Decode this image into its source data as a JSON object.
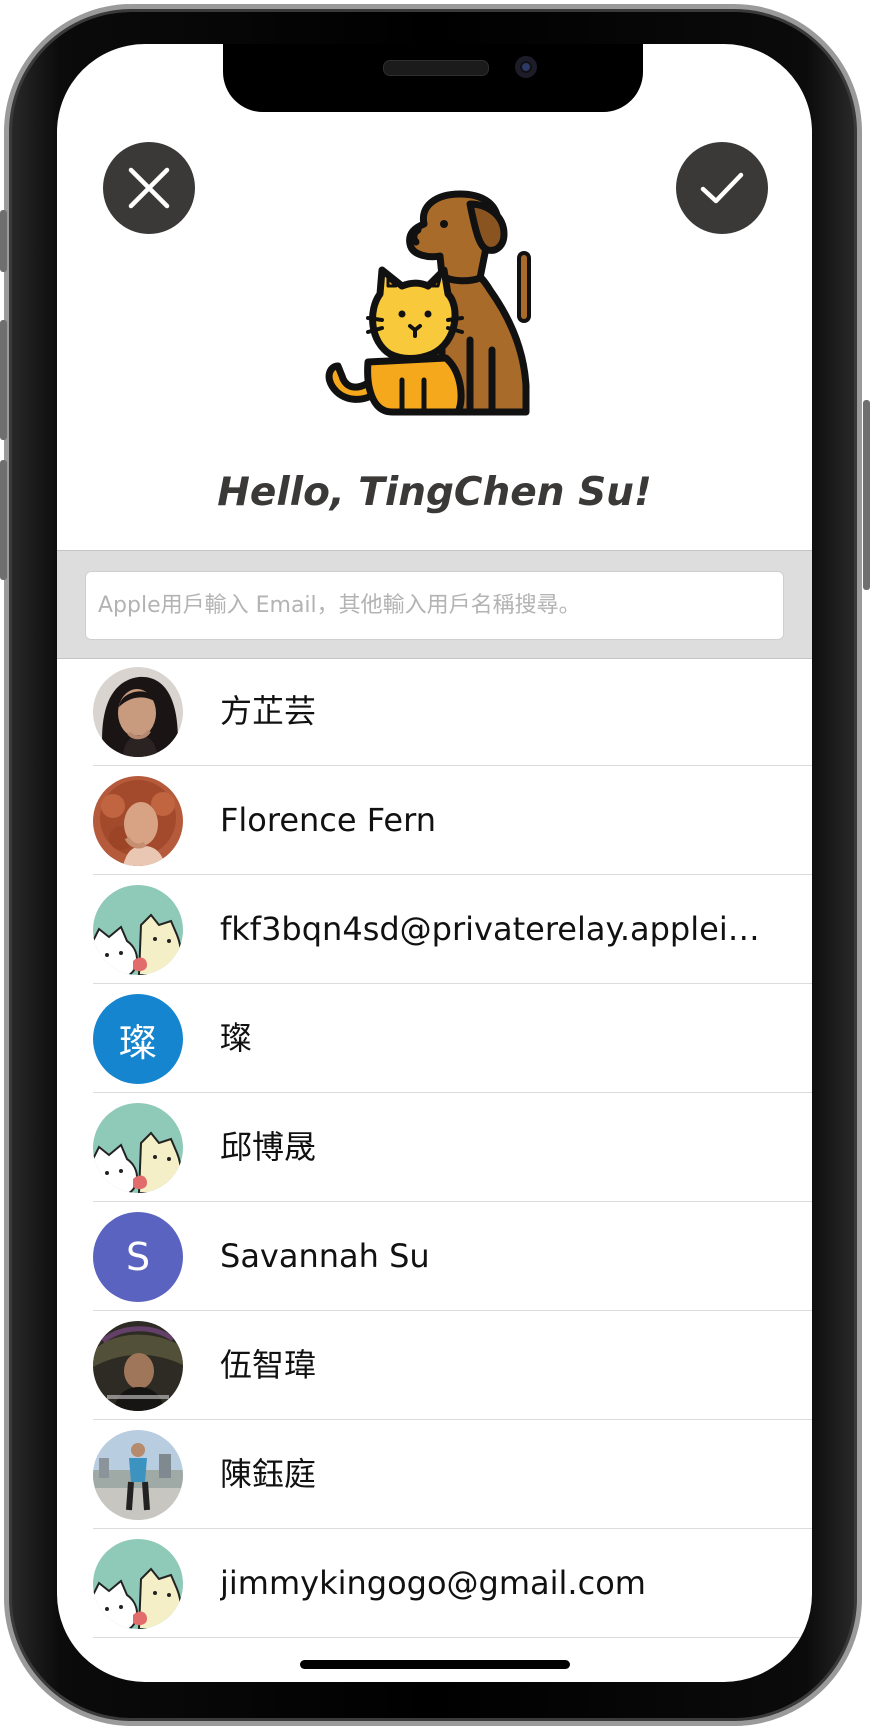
{
  "header": {
    "cancel_icon": "close-icon",
    "confirm_icon": "checkmark-icon",
    "greeting": "Hello, TingChen Su!"
  },
  "search": {
    "placeholder": "Apple用戶輸入 Email，其他輸入用戶名稱搜尋。"
  },
  "contacts": [
    {
      "name": "方芷芸",
      "avatar": "photo"
    },
    {
      "name": "Florence Fern",
      "avatar": "photo"
    },
    {
      "name": "fkf3bqn4sd@privaterelay.appleid…",
      "avatar": "pets-default"
    },
    {
      "name": "璨",
      "avatar": "initial",
      "initial": "璨",
      "color": "#1685cf"
    },
    {
      "name": "邱博晟",
      "avatar": "pets-default"
    },
    {
      "name": "Savannah Su",
      "avatar": "initial",
      "initial": "S",
      "color": "#5b63c1"
    },
    {
      "name": "伍智瑋",
      "avatar": "photo"
    },
    {
      "name": "陳鈺庭",
      "avatar": "photo"
    },
    {
      "name": "jimmykingogo@gmail.com",
      "avatar": "pets-default"
    }
  ],
  "colors": {
    "button_bg": "#3b3838",
    "search_bar_bg": "#dddddd",
    "divider": "#dcdcdc"
  }
}
